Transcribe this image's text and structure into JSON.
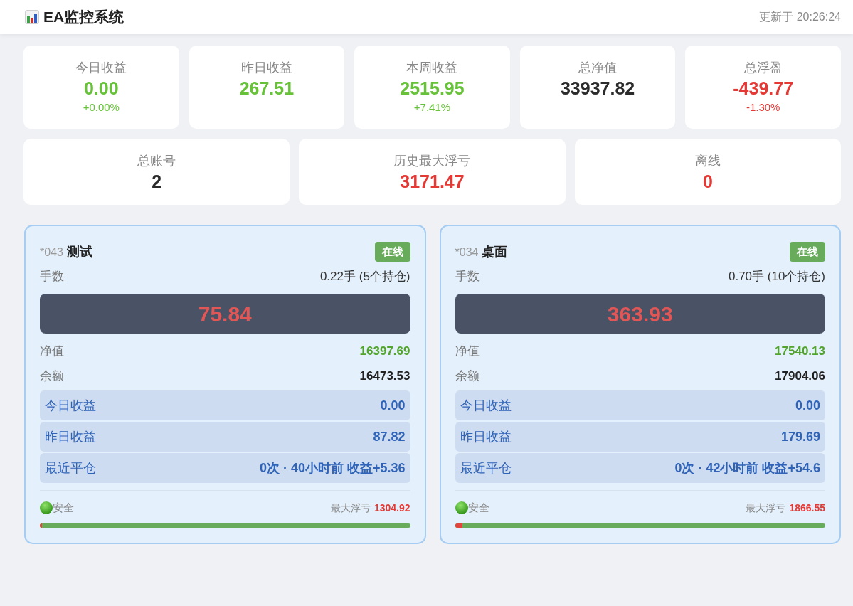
{
  "header": {
    "title": "EA监控系统",
    "updated": "更新于 20:26:24"
  },
  "summary": [
    {
      "label": "今日收益",
      "value": "0.00",
      "change": "+0.00%",
      "color": "#67c23a"
    },
    {
      "label": "昨日收益",
      "value": "267.51",
      "color": "#67c23a"
    },
    {
      "label": "本周收益",
      "value": "2515.95",
      "change": "+7.41%",
      "color": "#67c23a"
    },
    {
      "label": "总净值",
      "value": "33937.82",
      "color": "#2b2b2b"
    },
    {
      "label": "总浮盈",
      "value": "-439.77",
      "change": "-1.30%",
      "color": "#e53935"
    }
  ],
  "totals": [
    {
      "label": "总账号",
      "value": "2",
      "color": "#2b2b2b"
    },
    {
      "label": "历史最大浮亏",
      "value": "3171.47",
      "color": "#e53935"
    },
    {
      "label": "离线",
      "value": "0",
      "color": "#e53935"
    }
  ],
  "accounts": [
    {
      "id": "*043",
      "name": "测试",
      "status": {
        "label": "在线",
        "online": true
      },
      "lots": {
        "label": "手数",
        "value": "0.22手 (5个持仓)"
      },
      "floating": {
        "value": "75.84"
      },
      "rows": [
        {
          "kind": "plain",
          "label": "净值",
          "value": "16397.69",
          "color": "#52a42e"
        },
        {
          "kind": "plain",
          "label": "余额",
          "value": "16473.53",
          "color": "#222222"
        },
        {
          "kind": "highlight",
          "label": "今日收益",
          "value": "0.00"
        },
        {
          "kind": "highlight",
          "label": "昨日收益",
          "value": "87.82"
        },
        {
          "kind": "highlight",
          "label": "最近平仓",
          "value": "0次 · 40小时前 收益+5.36"
        }
      ],
      "risk": {
        "label": "安全",
        "safe": true
      },
      "drawdown": {
        "label": "最大浮亏",
        "value": "1304.92",
        "level": 0.005
      }
    },
    {
      "id": "*034",
      "name": "桌面",
      "status": {
        "label": "在线",
        "online": true
      },
      "lots": {
        "label": "手数",
        "value": "0.70手 (10个持仓)"
      },
      "floating": {
        "value": "363.93"
      },
      "rows": [
        {
          "kind": "plain",
          "label": "净值",
          "value": "17540.13",
          "color": "#52a42e"
        },
        {
          "kind": "plain",
          "label": "余额",
          "value": "17904.06",
          "color": "#222222"
        },
        {
          "kind": "highlight",
          "label": "今日收益",
          "value": "0.00"
        },
        {
          "kind": "highlight",
          "label": "昨日收益",
          "value": "179.69"
        },
        {
          "kind": "highlight",
          "label": "最近平仓",
          "value": "0次 · 42小时前 收益+54.6"
        }
      ],
      "risk": {
        "label": "安全",
        "safe": true
      },
      "drawdown": {
        "label": "最大浮亏",
        "value": "1866.55",
        "level": 0.02
      }
    }
  ]
}
